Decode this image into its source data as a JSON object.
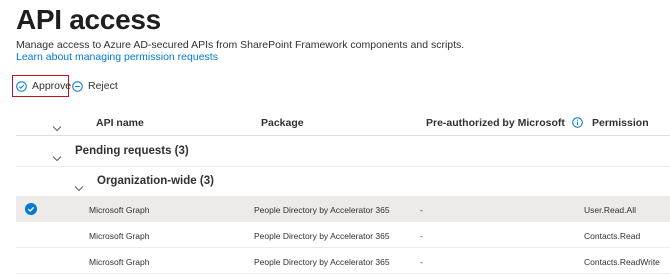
{
  "page": {
    "title": "API access",
    "description": "Manage access to Azure AD-secured APIs from SharePoint Framework components and scripts.",
    "learn_link": "Learn about managing permission requests"
  },
  "toolbar": {
    "approve_label": "Approve",
    "reject_label": "Reject"
  },
  "table": {
    "headers": {
      "api_name": "API name",
      "package": "Package",
      "pre_authorized": "Pre-authorized by Microsoft",
      "permission": "Permission"
    },
    "group": "Pending requests (3)",
    "subgroup": "Organization-wide (3)",
    "rows": [
      {
        "api_name": "Microsoft Graph",
        "package": "People Directory by Accelerator 365",
        "pre_authorized": "-",
        "permission": "User.Read.All",
        "selected": true
      },
      {
        "api_name": "Microsoft Graph",
        "package": "People Directory by Accelerator 365",
        "pre_authorized": "-",
        "permission": "Contacts.Read",
        "selected": false
      },
      {
        "api_name": "Microsoft Graph",
        "package": "People Directory by Accelerator 365",
        "pre_authorized": "-",
        "permission": "Contacts.ReadWrite",
        "selected": false
      }
    ]
  },
  "colors": {
    "accent": "#0078d4",
    "highlight_border": "#c50f1f",
    "selected_row": "#edebe9"
  }
}
